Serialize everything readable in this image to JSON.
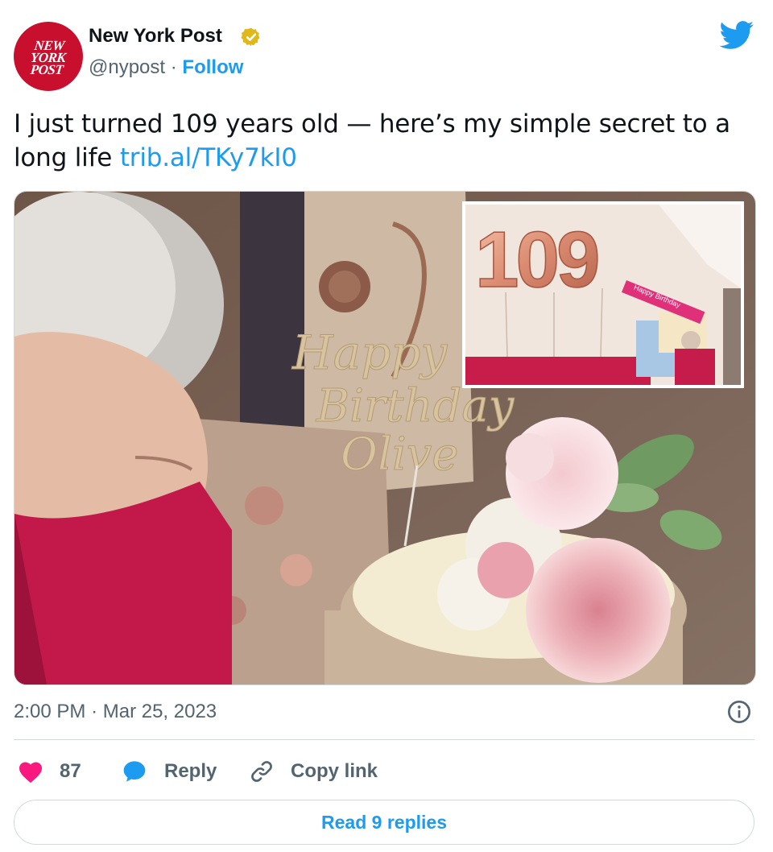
{
  "author": {
    "name": "New York Post",
    "handle": "@nypost",
    "separator": "·",
    "follow_label": "Follow",
    "avatar_logo_lines": [
      "NEW",
      "YORK",
      "POST"
    ],
    "verified_color": "#e2b719",
    "avatar_color": "#c8102e"
  },
  "tweet": {
    "text": "I just turned 109 years old — here’s my simple secret to a long life ",
    "link": "trib.al/TKy7kI0"
  },
  "media": {
    "cake_topper_lines": [
      "Happy",
      "Birthday",
      "Olive"
    ],
    "balloon_number": "109",
    "sash_text": "Happy Birthday"
  },
  "meta": {
    "time": "2:00 PM",
    "separator": "·",
    "date": "Mar 25, 2023"
  },
  "actions": {
    "like_count": "87",
    "reply_label": "Reply",
    "copy_link_label": "Copy link"
  },
  "read_replies_label": "Read 9 replies",
  "colors": {
    "accent": "#1d9bf0",
    "like": "#f91880",
    "muted": "#536471",
    "border": "#cfd9de"
  },
  "icons": [
    "verified-badge-icon",
    "twitter-bird-icon",
    "info-icon",
    "heart-icon",
    "reply-bubble-icon",
    "link-icon"
  ]
}
